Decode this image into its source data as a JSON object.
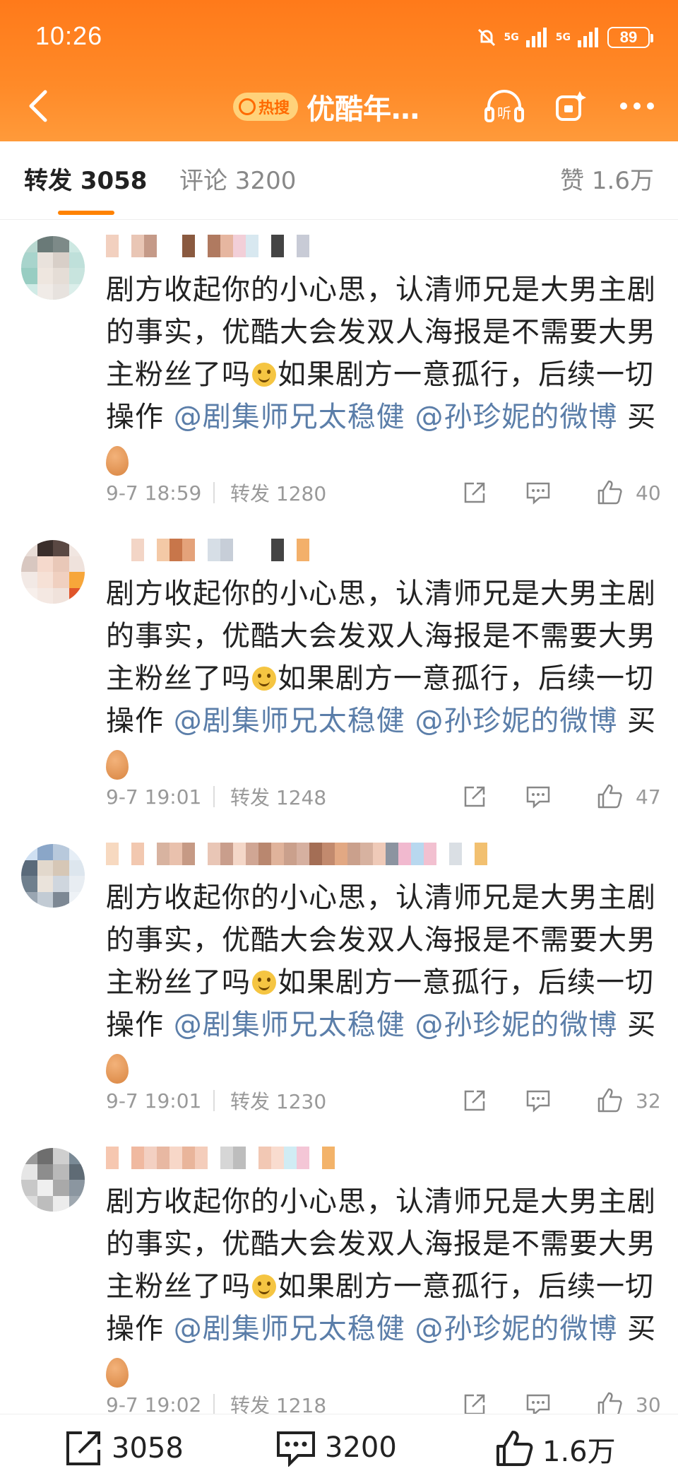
{
  "status": {
    "time": "10:26",
    "signal_1": "5G",
    "signal_2": "5G",
    "battery": "89"
  },
  "nav": {
    "hot_badge": "热搜",
    "title": "优酷年…"
  },
  "tabs": {
    "repost": "转发 3058",
    "comments": "评论 3200",
    "likes": "赞 1.6万"
  },
  "comments": [
    {
      "text_a": "剧方收起你的小心思，认清师兄是大男主剧的事实，优酷大会发双人海报是不需要大男主粉丝了吗",
      "text_b": "如果剧方一意孤行，后续一切操作 ",
      "mention_1": "@剧集师兄太稳健",
      "mention_2": "@孙珍妮的微博",
      "text_c": " 买",
      "time": "9-7 18:59",
      "repost": "转发 1280",
      "likes": "40"
    },
    {
      "text_a": "剧方收起你的小心思，认清师兄是大男主剧的事实，优酷大会发双人海报是不需要大男主粉丝了吗",
      "text_b": "如果剧方一意孤行，后续一切操作 ",
      "mention_1": "@剧集师兄太稳健",
      "mention_2": "@孙珍妮的微博",
      "text_c": " 买",
      "time": "9-7 19:01",
      "repost": "转发 1248",
      "likes": "47"
    },
    {
      "text_a": "剧方收起你的小心思，认清师兄是大男主剧的事实，优酷大会发双人海报是不需要大男主粉丝了吗",
      "text_b": "如果剧方一意孤行，后续一切操作 ",
      "mention_1": "@剧集师兄太稳健",
      "mention_2": "@孙珍妮的微博",
      "text_c": " 买",
      "time": "9-7 19:01",
      "repost": "转发 1230",
      "likes": "32"
    },
    {
      "text_a": "剧方收起你的小心思，认清师兄是大男主剧的事实，优酷大会发双人海报是不需要大男主粉丝了吗",
      "text_b": "如果剧方一意孤行，后续一切操作 ",
      "mention_1": "@剧集师兄太稳健",
      "mention_2": "@孙珍妮的微博",
      "text_c": " 买",
      "time": "9-7 19:02",
      "repost": "转发 1218",
      "likes": "30"
    }
  ],
  "bottom": {
    "repost_count": "3058",
    "comment_count": "3200",
    "like_count": "1.6万"
  },
  "colors": {
    "header": "#ff8a28",
    "accent": "#ff8200",
    "mention": "#5b7ea9"
  },
  "icons": [
    "back-arrow-icon",
    "listen-icon",
    "camera-sparkle-icon",
    "more-dots-icon",
    "share-icon",
    "comment-icon",
    "thumb-up-icon"
  ]
}
